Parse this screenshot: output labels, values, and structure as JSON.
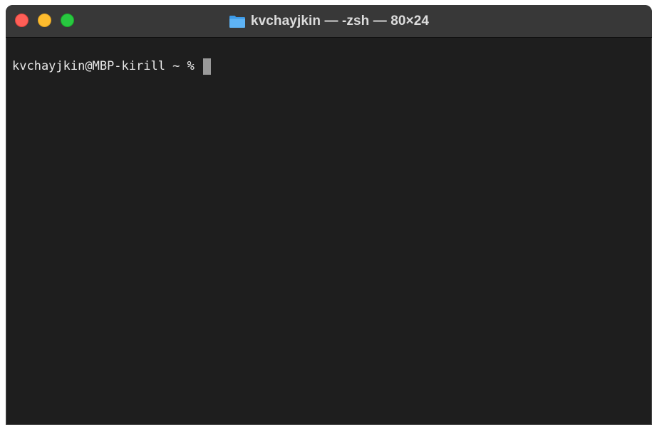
{
  "window": {
    "title": "kvchayjkin — -zsh — 80×24",
    "title_icon": "folder-icon",
    "controls": [
      {
        "name": "close",
        "color": "#ff5f57"
      },
      {
        "name": "minimize",
        "color": "#febc2e"
      },
      {
        "name": "zoom",
        "color": "#28c840"
      }
    ]
  },
  "terminal": {
    "prompt": "kvchayjkin@MBP-kirill ~ % ",
    "background": "#1e1e1e",
    "foreground": "#e8e8e8"
  }
}
